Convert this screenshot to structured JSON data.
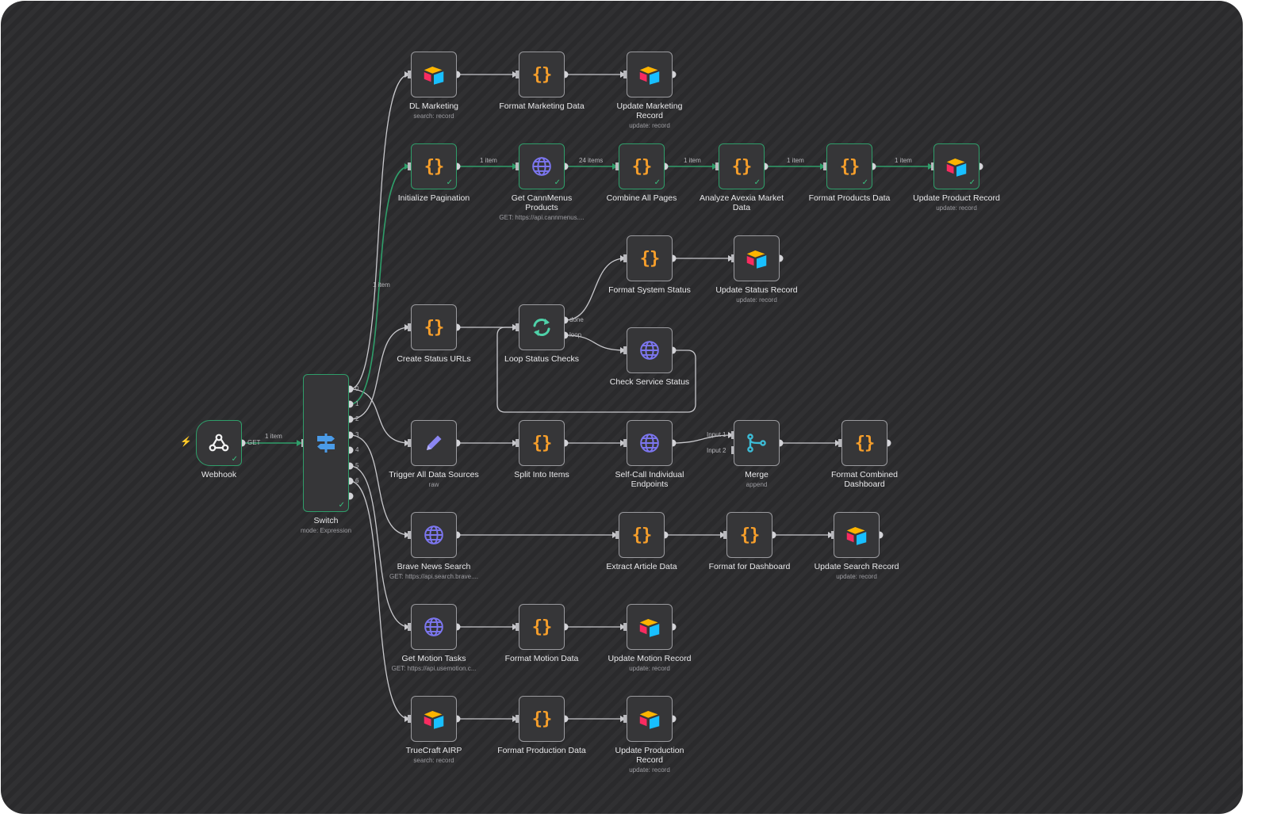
{
  "canvas": {
    "trigger_marker": "⚡",
    "colors": {
      "background": "#2a2a2c",
      "wire": "#c8c8cc",
      "wire_active": "#2f9e6a",
      "node_border": "#9a9a9e",
      "node_fill": "#363638",
      "node_success": "#2f9e6a",
      "code_icon": "#f59e2b",
      "http_icon": "#7c76f0"
    }
  },
  "edge_labels": {
    "webhook_get": "GET",
    "webhook_switch": "1 item",
    "switch_pagination": "1 item",
    "pagination_get": "1 item",
    "get_combine": "24 items",
    "combine_analyze": "1 item",
    "analyze_format": "1 item",
    "format_update": "1 item",
    "loop_done": "done",
    "loop_loop": "loop",
    "merge_input1": "Input 1",
    "merge_input2": "Input 2",
    "switch_outputs": [
      "0",
      "1",
      "2",
      "3",
      "4",
      "5",
      "6"
    ]
  },
  "nodes": {
    "webhook": {
      "label": "Webhook",
      "icon": "webhook-icon"
    },
    "switch": {
      "label": "Switch",
      "sub": "mode: Expression",
      "icon": "signpost-icon"
    },
    "dl_marketing": {
      "label": "DL Marketing",
      "sub": "search: record",
      "icon": "airtable-icon"
    },
    "format_marketing": {
      "label": "Format Marketing Data",
      "icon": "code-icon",
      "glyph": "{}"
    },
    "update_marketing": {
      "label": "Update Marketing Record",
      "sub": "update: record",
      "icon": "airtable-icon"
    },
    "init_pagination": {
      "label": "Initialize Pagination",
      "icon": "code-icon",
      "glyph": "{}"
    },
    "get_cannmenus": {
      "label": "Get CannMenus Products",
      "sub": "GET: https://api.cannmenus....",
      "icon": "globe-icon"
    },
    "combine_pages": {
      "label": "Combine All Pages",
      "icon": "code-icon",
      "glyph": "{}"
    },
    "analyze_avexia": {
      "label": "Analyze Avexia Market Data",
      "icon": "code-icon",
      "glyph": "{}"
    },
    "format_products": {
      "label": "Format Products Data",
      "icon": "code-icon",
      "glyph": "{}"
    },
    "update_product": {
      "label": "Update Product Record",
      "sub": "update: record",
      "icon": "airtable-icon"
    },
    "format_system_status": {
      "label": "Format System Status",
      "icon": "code-icon",
      "glyph": "{}"
    },
    "update_status": {
      "label": "Update Status Record",
      "sub": "update: record",
      "icon": "airtable-icon"
    },
    "create_status_urls": {
      "label": "Create Status URLs",
      "icon": "code-icon",
      "glyph": "{}"
    },
    "loop_status": {
      "label": "Loop Status Checks",
      "icon": "loop-icon"
    },
    "check_service": {
      "label": "Check Service Status",
      "icon": "globe-icon"
    },
    "trigger_all": {
      "label": "Trigger All Data Sources",
      "sub": "raw",
      "icon": "pencil-icon"
    },
    "split_items": {
      "label": "Split Into Items",
      "icon": "code-icon",
      "glyph": "{}"
    },
    "self_call": {
      "label": "Self-Call Individual Endpoints",
      "icon": "globe-icon"
    },
    "merge": {
      "label": "Merge",
      "sub": "append",
      "icon": "merge-icon"
    },
    "format_combined": {
      "label": "Format Combined Dashboard",
      "icon": "code-icon",
      "glyph": "{}"
    },
    "brave_search": {
      "label": "Brave News Search",
      "sub": "GET: https://api.search.brave....",
      "icon": "globe-icon"
    },
    "extract_article": {
      "label": "Extract Article Data",
      "icon": "code-icon",
      "glyph": "{}"
    },
    "format_dashboard": {
      "label": "Format for Dashboard",
      "icon": "code-icon",
      "glyph": "{}"
    },
    "update_search": {
      "label": "Update Search Record",
      "sub": "update: record",
      "icon": "airtable-icon"
    },
    "get_motion": {
      "label": "Get Motion Tasks",
      "sub": "GET: https://api.usemotion.c...",
      "icon": "globe-icon"
    },
    "format_motion": {
      "label": "Format Motion Data",
      "icon": "code-icon",
      "glyph": "{}"
    },
    "update_motion": {
      "label": "Update Motion Record",
      "sub": "update: record",
      "icon": "airtable-icon"
    },
    "truecraft": {
      "label": "TrueCraft AIRP",
      "sub": "search: record",
      "icon": "airtable-icon"
    },
    "format_production": {
      "label": "Format Production Data",
      "icon": "code-icon",
      "glyph": "{}"
    },
    "update_production": {
      "label": "Update Production Record",
      "sub": "update: record",
      "icon": "airtable-icon"
    }
  }
}
